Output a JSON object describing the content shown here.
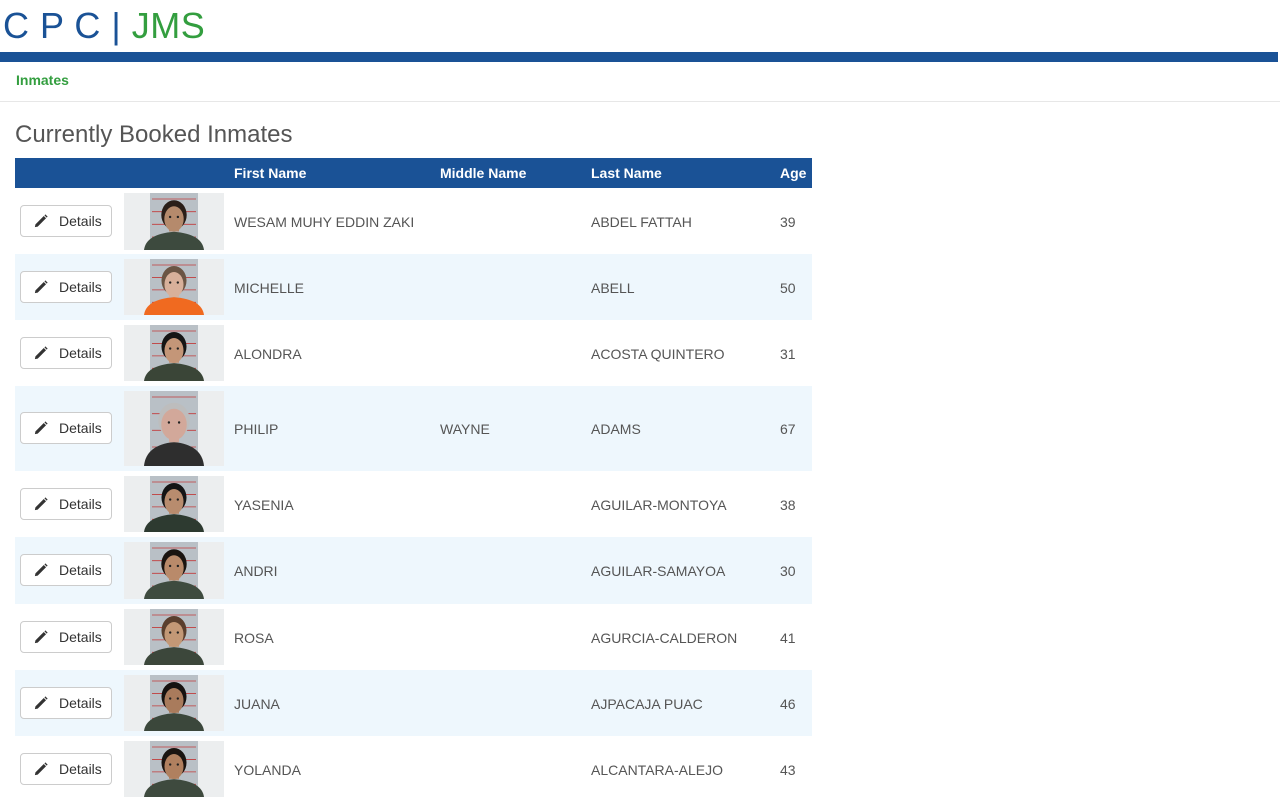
{
  "brand": {
    "part1": "C P C",
    "separator": "|",
    "part2": "JMS"
  },
  "nav": {
    "inmates_label": "Inmates"
  },
  "page_title": "Currently Booked Inmates",
  "table": {
    "columns": [
      "",
      "",
      "First Name",
      "Middle Name",
      "Last Name",
      "Age"
    ],
    "button_label": "Details",
    "rows": [
      {
        "first": "WESAM MUHY EDDIN ZAKI",
        "middle": "",
        "last": "ABDEL FATTAH",
        "age": "39",
        "shirt": "#3d4a3e",
        "skin": "#b58a6c",
        "hair": "#2a1e18"
      },
      {
        "first": "MICHELLE",
        "middle": "",
        "last": "ABELL",
        "age": "50",
        "shirt": "#f06a20",
        "skin": "#d8b09a",
        "hair": "#6b5544"
      },
      {
        "first": "ALONDRA",
        "middle": "",
        "last": "ACOSTA QUINTERO",
        "age": "31",
        "shirt": "#3a4537",
        "skin": "#c49678",
        "hair": "#151515"
      },
      {
        "first": "PHILIP",
        "middle": "WAYNE",
        "last": "ADAMS",
        "age": "67",
        "shirt": "#2e2e2e",
        "skin": "#d2a89a",
        "hair": "#bdbdbd"
      },
      {
        "first": "YASENIA",
        "middle": "",
        "last": "AGUILAR-MONTOYA",
        "age": "38",
        "shirt": "#2d3a30",
        "skin": "#b88c6e",
        "hair": "#151515"
      },
      {
        "first": "ANDRI",
        "middle": "",
        "last": "AGUILAR-SAMAYOA",
        "age": "30",
        "shirt": "#3e4b3f",
        "skin": "#b98a6a",
        "hair": "#1a1410"
      },
      {
        "first": "ROSA",
        "middle": "",
        "last": "AGURCIA-CALDERON",
        "age": "41",
        "shirt": "#3c473b",
        "skin": "#c39876",
        "hair": "#5a3f2e"
      },
      {
        "first": "JUANA",
        "middle": "",
        "last": "AJPACAJA PUAC",
        "age": "46",
        "shirt": "#3b473b",
        "skin": "#a97b5c",
        "hair": "#161210"
      },
      {
        "first": "YOLANDA",
        "middle": "",
        "last": "ALCANTARA-ALEJO",
        "age": "43",
        "shirt": "#3e4a3e",
        "skin": "#b0805f",
        "hair": "#1a1410"
      }
    ]
  },
  "colors": {
    "brand_blue": "#1a5296",
    "brand_green": "#339e3f",
    "row_alt": "#eef7fd"
  }
}
